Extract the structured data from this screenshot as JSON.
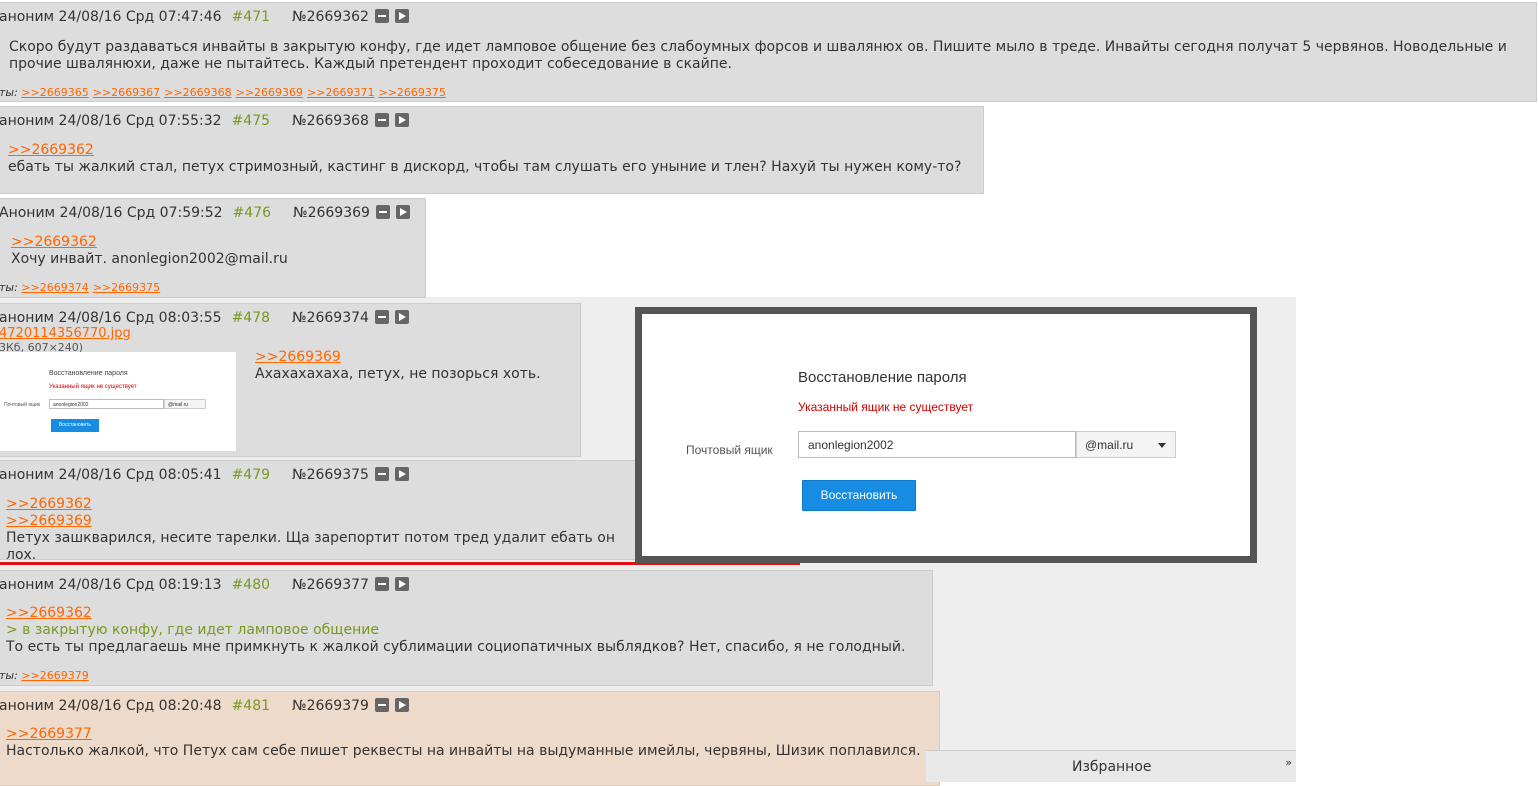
{
  "posts": [
    {
      "header": {
        "name": "аноним 24/08/16 Срд 07:47:46",
        "num": "#471",
        "no": "№2669362"
      },
      "lines": [
        "Скоро будут раздаваться инвайты в закрытую конфу, где идет ламповое общение без слабоумных форсов и швалянюх ов. Пишите мыло в треде. Инвайты сегодня получат 5 червянов. Новодельные и",
        "прочие швалянюхи, даже не пытайтесь. Каждый претендент проходит собеседование в скайпе."
      ],
      "replies_label": "ты:",
      "replies": [
        ">>2669365",
        ">>2669367",
        ">>2669368",
        ">>2669369",
        ">>2669371",
        ">>2669375"
      ]
    },
    {
      "header": {
        "name": "аноним 24/08/16 Срд 07:55:32",
        "num": "#475",
        "no": "№2669368"
      },
      "link": ">>2669362",
      "text": "ебать ты жалкий стал, петух стримозный, кастинг в дискорд, чтобы там слушать его уныние и тлен? Нахуй ты нужен кому-то?"
    },
    {
      "header": {
        "name": "Аноним 24/08/16 Срд 07:59:52",
        "num": "#476",
        "no": "№2669369"
      },
      "link": ">>2669362",
      "text": "Хочу инвайт. anonlegion2002@mail.ru",
      "replies_label": "ты:",
      "replies": [
        ">>2669374",
        ">>2669375"
      ]
    },
    {
      "header": {
        "name": "аноним 24/08/16 Срд 08:03:55",
        "num": "#478",
        "no": "№2669374"
      },
      "file_name": "4720114356770.jpg",
      "file_info": "3Кб, 607×240)",
      "link": ">>2669369",
      "text": "Ахахахахаха, петух, не позорься хоть.",
      "thumb": {
        "title": "Восстановление пароля",
        "error": "Указанный ящик не существует",
        "label": "Почтовый ящик",
        "input": "anonlegion2002",
        "domain": "@mail.ru",
        "button": "Восстановить"
      }
    },
    {
      "header": {
        "name": "аноним 24/08/16 Срд 08:05:41",
        "num": "#479",
        "no": "№2669375"
      },
      "links": [
        ">>2669362",
        ">>2669369"
      ],
      "text": "Петух зашкварился, несите тарелки. Ща зарепортит потом тред удалит ебать он лох."
    },
    {
      "header": {
        "name": "аноним 24/08/16 Срд 08:19:13",
        "num": "#480",
        "no": "№2669377"
      },
      "link": ">>2669362",
      "quote": "> в закрытую конфу, где идет ламповое общение",
      "text": "То есть ты предлагаешь мне примкнуть к жалкой сублимации социопатичных выблядков? Нет, спасибо, я не голодный.",
      "replies_label": "ты:",
      "replies": [
        ">>2669379"
      ]
    },
    {
      "header": {
        "name": "аноним 24/08/16 Срд 08:20:48",
        "num": "#481",
        "no": "№2669379"
      },
      "link": ">>2669377",
      "text": "Настолько жалкой, что Петух сам себе пишет реквесты на инвайты на выдуманные имейлы, червяны, Шизик поплавился."
    }
  ],
  "modal": {
    "title": "Восстановление пароля",
    "error": "Указанный ящик не существует",
    "label": "Почтовый ящик",
    "input_value": "anonlegion2002",
    "domain": "@mail.ru",
    "button": "Восстановить"
  },
  "favorites": {
    "label": "Избранное",
    "chevron": "»"
  },
  "colors": {
    "link": "#ff6600",
    "quote": "#789922",
    "post_bg": "#dddddd",
    "highlight_bg": "#eedacb",
    "button": "#168de2",
    "error": "#cc0000"
  },
  "icons": [
    "minus-icon",
    "play-icon",
    "caret-down-icon",
    "chevron-double-icon"
  ]
}
